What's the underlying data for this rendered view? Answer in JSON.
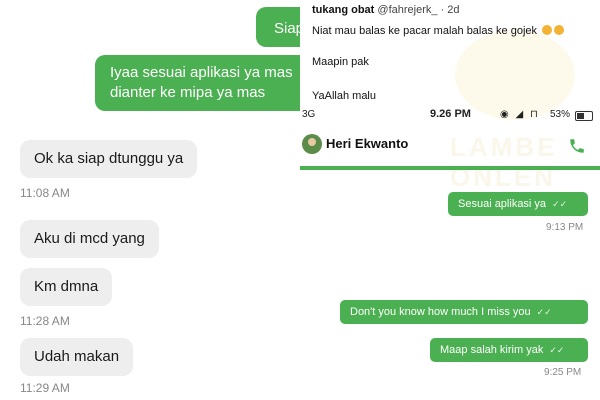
{
  "left_chat": {
    "outgoing": [
      {
        "text": "Siap"
      },
      {
        "line1": "Iyaa sesuai aplikasi ya mas",
        "line2": "dianter ke mipa ya mas"
      }
    ],
    "incoming": [
      {
        "text": "Ok ka siap dtunggu ya",
        "time": "11:08 AM"
      },
      {
        "text": "Aku di mcd yang"
      },
      {
        "text": "Km dmna",
        "time": "11:28 AM"
      },
      {
        "text": "Udah makan",
        "time": "11:29 AM"
      }
    ]
  },
  "tweet": {
    "user": "tukang obat",
    "handle": "@fahrejerk_",
    "age": "2d",
    "lines": [
      "Niat mau balas ke pacar malah balas ke gojek",
      "Maapin pak",
      "YaAllah malu"
    ],
    "emoji": "crying-face-icon"
  },
  "watermark": {
    "line1": "LAMBE",
    "line2": "ONLEN"
  },
  "phone_status": {
    "carrier": "3G",
    "time": "9.26 PM",
    "icons": "◉ ◢ ⊓",
    "battery": "53%",
    "battery_level": 0.53
  },
  "right_chat": {
    "contact": "Heri Ekwanto",
    "messages": [
      {
        "text": "Sesuai aplikasi ya",
        "time": "9:13 PM"
      },
      {
        "text": "Don't you know how much I miss you"
      },
      {
        "text": "Maap salah kirim yak",
        "time": "9:25 PM"
      }
    ],
    "check": "✓✓"
  },
  "colors": {
    "bubble_green": "#4bb051",
    "bubble_gray": "#eeeeee"
  }
}
